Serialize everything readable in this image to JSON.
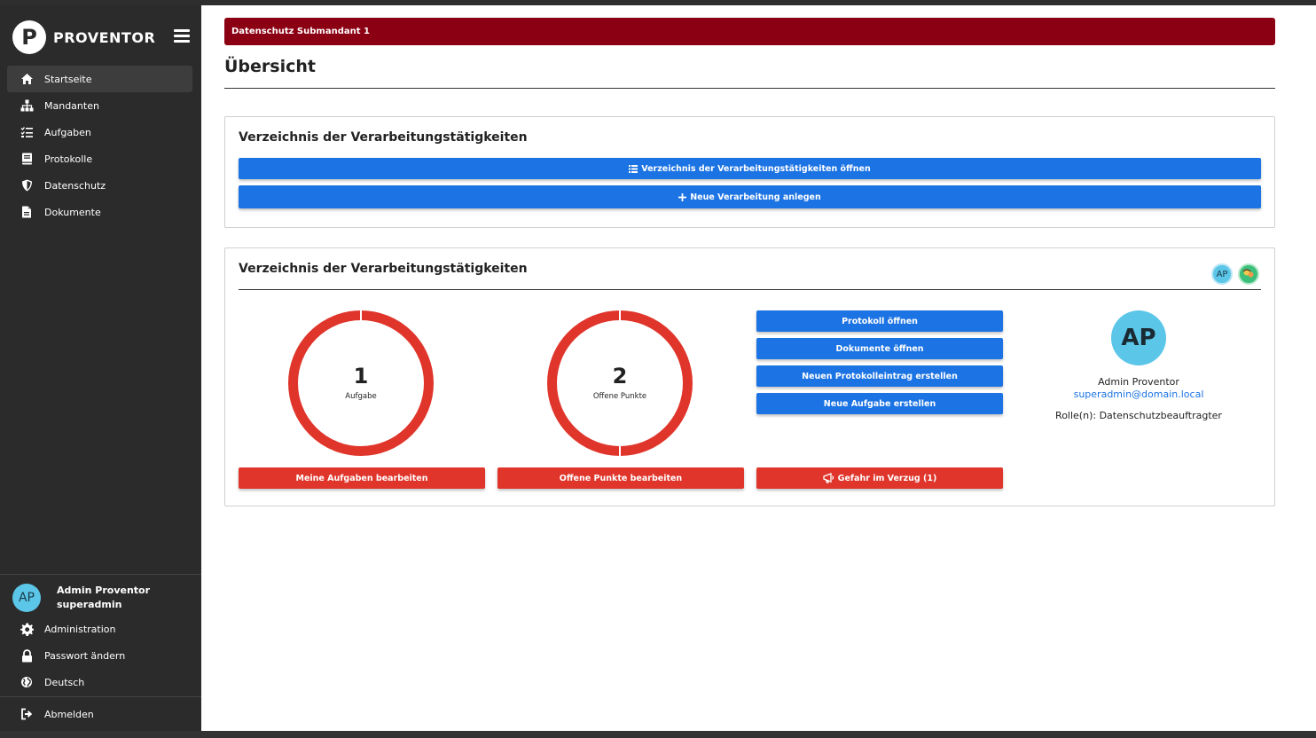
{
  "brand": {
    "logo_letter": "P",
    "name": "PROVENTOR"
  },
  "nav": {
    "items": [
      {
        "label": "Startseite",
        "icon": "home-icon",
        "active": true
      },
      {
        "label": "Mandanten",
        "icon": "sitemap-icon"
      },
      {
        "label": "Aufgaben",
        "icon": "tasks-icon"
      },
      {
        "label": "Protokolle",
        "icon": "book-icon"
      },
      {
        "label": "Datenschutz",
        "icon": "shield-icon"
      },
      {
        "label": "Dokumente",
        "icon": "document-icon"
      }
    ]
  },
  "user": {
    "initials": "AP",
    "name": "Admin Proventor",
    "username": "superadmin",
    "email": "superadmin@domain.local",
    "role_text": "Rolle(n): Datenschutzbeauftragter"
  },
  "sidebar_bottom": {
    "administration": "Administration",
    "password": "Passwort ändern",
    "language": "Deutsch",
    "logout": "Abmelden"
  },
  "alert": {
    "text": "Datenschutz Submandant 1"
  },
  "page": {
    "title": "Übersicht"
  },
  "card1": {
    "title": "Verzeichnis der Verarbeitungstätigkeiten",
    "open_button": "Verzeichnis der Verarbeitungstätigkeiten öffnen",
    "new_button": "Neue Verarbeitung anlegen"
  },
  "card2": {
    "title": "Verzeichnis der Verarbeitungstätigkeiten",
    "ring1": {
      "value": "1",
      "label": "Aufgabe",
      "button": "Meine Aufgaben bearbeiten"
    },
    "ring2": {
      "value": "2",
      "label": "Offene Punkte",
      "button": "Offene Punkte bearbeiten"
    },
    "actions": {
      "protokoll": "Protokoll öffnen",
      "dokumente": "Dokumente öffnen",
      "neuer_eintrag": "Neuen Protokolleintrag erstellen",
      "neue_aufgabe": "Neue Aufgabe erstellen",
      "gefahr": "Gefahr im Verzug (1)"
    }
  },
  "colors": {
    "sidebar_bg": "#2b2b2b",
    "alert_bg": "#8b0012",
    "primary_blue": "#1c73e3",
    "danger_red": "#e0352b",
    "avatar_bg": "#5bc6e8"
  }
}
